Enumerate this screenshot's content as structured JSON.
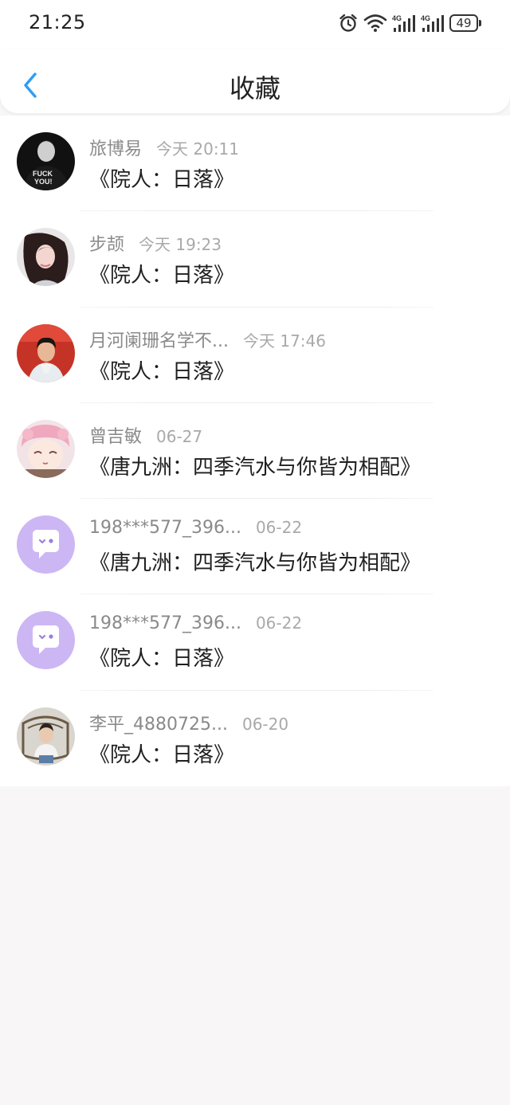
{
  "status_bar": {
    "time": "21:25",
    "network_1": "4G",
    "network_2": "4G",
    "battery": "49"
  },
  "header": {
    "back_icon": "chevron-left-icon",
    "title": "收藏"
  },
  "favorites": [
    {
      "name": "旅博易",
      "time": "今天 20:11",
      "title": "《院人：日落》",
      "avatar": "photo-bw"
    },
    {
      "name": "步颉",
      "time": "今天 19:23",
      "title": "《院人：日落》",
      "avatar": "photo-girl"
    },
    {
      "name": "月河阑珊名学不...",
      "time": "今天 17:46",
      "title": "《院人：日落》",
      "avatar": "photo-boy"
    },
    {
      "name": "曾吉敏",
      "time": "06-27",
      "title": "《唐九洲：四季汽水与你皆为相配》",
      "avatar": "anime"
    },
    {
      "name": "198***577_396...",
      "time": "06-22",
      "title": "《唐九洲：四季汽水与你皆为相配》",
      "avatar": "default-chat"
    },
    {
      "name": "198***577_396...",
      "time": "06-22",
      "title": "《院人：日落》",
      "avatar": "default-chat"
    },
    {
      "name": "李平_4880725...",
      "time": "06-20",
      "title": "《院人：日落》",
      "avatar": "photo-chair"
    }
  ],
  "colors": {
    "accent": "#2f9df4",
    "default_avatar": "#cdb6f4"
  }
}
